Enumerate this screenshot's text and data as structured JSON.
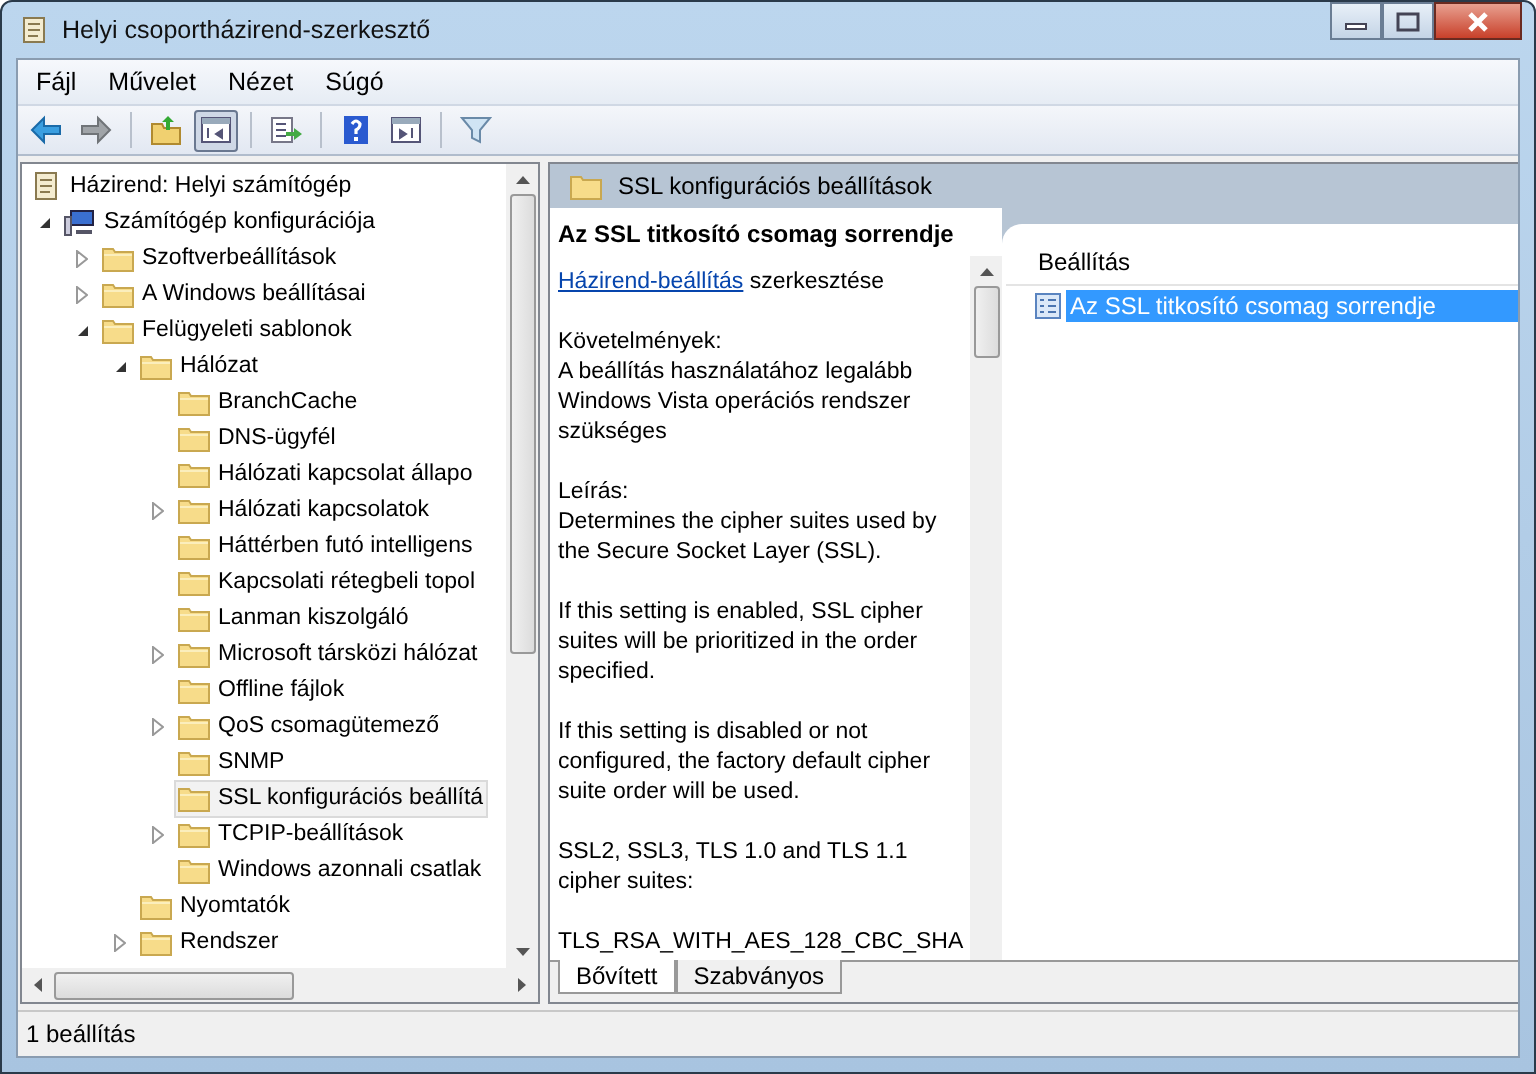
{
  "window": {
    "title": "Helyi csoportházirend-szerkesztő"
  },
  "menu": [
    "Fájl",
    "Művelet",
    "Nézet",
    "Súgó"
  ],
  "toolbar": [
    [
      {
        "kind": "back",
        "pressed": false
      },
      {
        "kind": "forward",
        "pressed": false
      }
    ],
    [
      {
        "kind": "up",
        "pressed": false
      },
      {
        "kind": "tree",
        "pressed": true
      }
    ],
    [
      {
        "kind": "export",
        "pressed": false
      }
    ],
    [
      {
        "kind": "help",
        "pressed": false
      },
      {
        "kind": "pane",
        "pressed": false
      }
    ],
    [
      {
        "kind": "filter",
        "pressed": false
      }
    ]
  ],
  "tree": [
    {
      "label": "Házirend: Helyi számítógép",
      "kind": "policy",
      "selected": false,
      "children": [
        {
          "label": "Számítógép konfigurációja",
          "kind": "computer",
          "expanded": true,
          "selected": false,
          "children": [
            {
              "label": "Szoftverbeállítások",
              "kind": "folder",
              "expanded": false,
              "selected": false
            },
            {
              "label": "A Windows beállításai",
              "kind": "folder",
              "expanded": false,
              "selected": false
            },
            {
              "label": "Felügyeleti sablonok",
              "kind": "folder",
              "expanded": true,
              "selected": false,
              "children": [
                {
                  "label": "Hálózat",
                  "kind": "folder",
                  "expanded": true,
                  "selected": false,
                  "children": [
                    {
                      "label": "BranchCache",
                      "kind": "folder",
                      "selected": false
                    },
                    {
                      "label": "DNS-ügyfél",
                      "kind": "folder",
                      "selected": false
                    },
                    {
                      "label": "Hálózati kapcsolat állapo",
                      "kind": "folder",
                      "selected": false
                    },
                    {
                      "label": "Hálózati kapcsolatok",
                      "kind": "folder",
                      "expanded": false,
                      "selected": false
                    },
                    {
                      "label": "Háttérben futó intelligens",
                      "kind": "folder",
                      "selected": false
                    },
                    {
                      "label": "Kapcsolati rétegbeli topol",
                      "kind": "folder",
                      "selected": false
                    },
                    {
                      "label": "Lanman kiszolgáló",
                      "kind": "folder",
                      "selected": false
                    },
                    {
                      "label": "Microsoft társközi hálózat",
                      "kind": "folder",
                      "expanded": false,
                      "selected": false
                    },
                    {
                      "label": "Offline fájlok",
                      "kind": "folder",
                      "selected": false
                    },
                    {
                      "label": "QoS csomagütemező",
                      "kind": "folder",
                      "expanded": false,
                      "selected": false
                    },
                    {
                      "label": "SNMP",
                      "kind": "folder",
                      "selected": false
                    },
                    {
                      "label": "SSL konfigurációs beállítá",
                      "kind": "folder",
                      "selected": true
                    },
                    {
                      "label": "TCPIP-beállítások",
                      "kind": "folder",
                      "expanded": false,
                      "selected": false
                    },
                    {
                      "label": "Windows azonnali csatlak",
                      "kind": "folder",
                      "selected": false
                    }
                  ]
                },
                {
                  "label": "Nyomtatók",
                  "kind": "folder",
                  "selected": false
                },
                {
                  "label": "Rendszer",
                  "kind": "folder",
                  "expanded": false,
                  "selected": false
                }
              ]
            }
          ]
        }
      ]
    }
  ],
  "header": {
    "title": "SSL konfigurációs beállítások"
  },
  "description": {
    "title": "Az SSL titkosító csomag sorrendje",
    "link": "Házirend-beállítás",
    "link_suffix": " szerkesztése",
    "paragraphs": [
      "Követelmények:\nA beállítás használatához legalább Windows Vista operációs rendszer szükséges",
      "Leírás:\nDetermines the cipher suites used by the Secure Socket Layer (SSL).",
      "If this setting is enabled, SSL cipher suites will be prioritized in the order specified.",
      "If this setting is disabled or not configured, the factory default cipher suite order will be used.",
      "SSL2, SSL3, TLS 1.0 and TLS 1.1 cipher suites:",
      "TLS_RSA_WITH_AES_128_CBC_SHA"
    ]
  },
  "list": {
    "column": "Beállítás",
    "rows": [
      {
        "label": "Az SSL titkosító csomag sorrendje",
        "selected": true
      }
    ]
  },
  "tabs": [
    {
      "label": "Bővített",
      "selected": true
    },
    {
      "label": "Szabványos",
      "selected": false
    }
  ],
  "status_bar": "1 beállítás"
}
